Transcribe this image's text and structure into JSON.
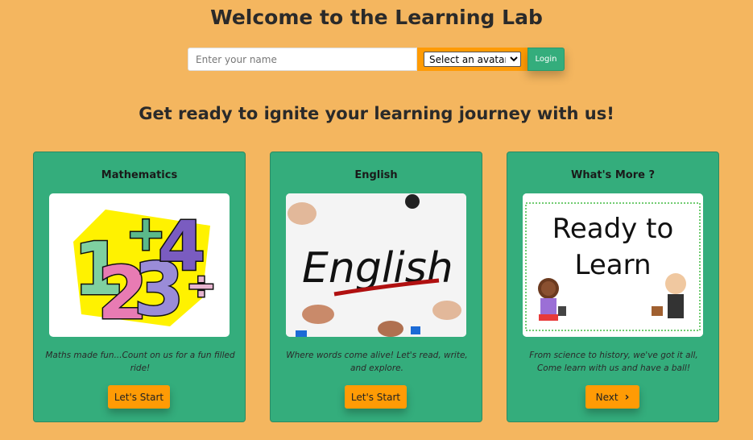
{
  "header": {
    "title": "Welcome to the Learning Lab"
  },
  "login": {
    "name_placeholder": "Enter your name",
    "name_value": "",
    "avatar_selected": "Select an avatar",
    "login_label": "Login"
  },
  "subtitle": "Get ready to ignite your learning journey with us!",
  "cards": [
    {
      "title": "Mathematics",
      "description": "Maths made fun...Count on us for a fun filled ride!",
      "button_label": "Let's Start",
      "image_text": "1 2 3 4 + ÷"
    },
    {
      "title": "English",
      "description": "Where words come alive! Let's read, write, and explore.",
      "button_label": "Let's Start",
      "image_text": "English"
    },
    {
      "title": "What's More ?",
      "description": "From science to history, we've got it all, Come learn with us and have a ball!",
      "button_label": "Next",
      "image_text_line1": "Ready to",
      "image_text_line2": "Learn"
    }
  ],
  "colors": {
    "background": "#f4b65f",
    "card": "#34ad7c",
    "accent": "#ff9b05"
  }
}
